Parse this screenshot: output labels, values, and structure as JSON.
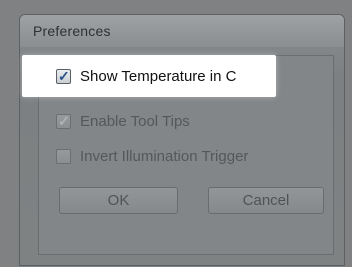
{
  "dialog": {
    "title": "Preferences"
  },
  "options": [
    {
      "label": "Show Temperature in C",
      "checked": true,
      "enabled": true,
      "highlighted": true
    },
    {
      "label": "Enable Tool Tips",
      "checked": true,
      "enabled": false,
      "highlighted": false
    },
    {
      "label": "Invert Illumination Trigger",
      "checked": false,
      "enabled": false,
      "highlighted": false
    }
  ],
  "buttons": {
    "ok_label": "OK",
    "cancel_label": "Cancel"
  },
  "icons": {
    "check": "checkmark-icon"
  },
  "colors": {
    "highlight": "#ffffff",
    "check_active": "#2b4f88",
    "background": "#7f8182"
  }
}
